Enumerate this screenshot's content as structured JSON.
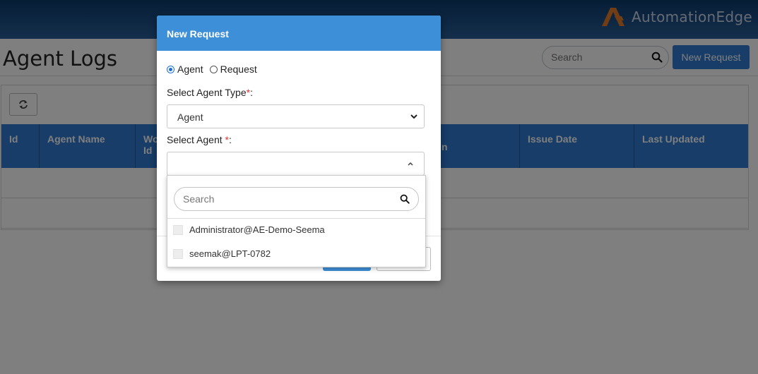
{
  "brand": {
    "name": "AutomationEdge"
  },
  "page": {
    "title": "Agent Logs",
    "search_placeholder": "Search",
    "new_request_label": "New Request"
  },
  "table": {
    "columns": [
      "Id",
      "Agent Name",
      "Wo\nId",
      "n",
      "Issue Date",
      "Last Updated"
    ]
  },
  "modal": {
    "title": "New Request",
    "radio_agent": "Agent",
    "radio_request": "Request",
    "agent_type_label": "Select Agent Type",
    "agent_type_value": "Agent",
    "select_agent_label": "Select Agent ",
    "required_mark": "*",
    "colon": ":"
  },
  "dropdown": {
    "search_placeholder": "Search",
    "items": [
      "Administrator@AE-Demo-Seema",
      "seemak@LPT-0782"
    ]
  },
  "colors": {
    "accent": "#2f7ad0",
    "modal_header": "#3d8fd8",
    "topbar": "#0c3a6c",
    "logo_orange": "#e07a2a"
  }
}
